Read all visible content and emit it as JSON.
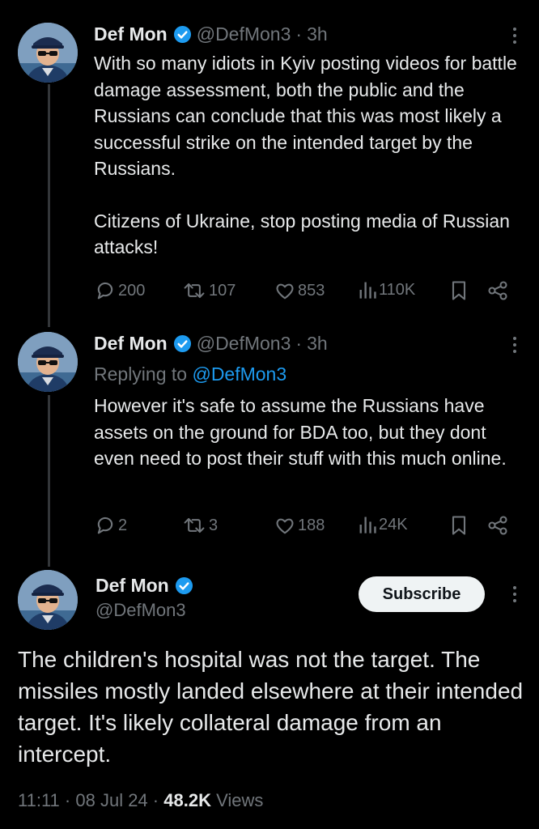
{
  "tweet1": {
    "name": "Def Mon",
    "handle": "@DefMon3",
    "separator": "·",
    "time": "3h",
    "paragraph1": "With so many idiots in Kyiv posting videos for battle damage assessment, both the public and the Russians can conclude that this was most likely a successful strike on the intended target by the Russians.",
    "paragraph2": "Citizens of Ukraine, stop posting media of Russian attacks!",
    "replies": "200",
    "reposts": "107",
    "likes": "853",
    "views": "110K"
  },
  "tweet2": {
    "name": "Def Mon",
    "handle": "@DefMon3",
    "separator": "·",
    "time": "3h",
    "replying_label": "Replying to",
    "replying_mention": "@DefMon3",
    "text": "However it's safe to assume the Russians have assets on the ground for BDA too, but they dont even need to post their stuff with this much online.",
    "replies": "2",
    "reposts": "3",
    "likes": "188",
    "views": "24K"
  },
  "main_tweet": {
    "name": "Def Mon",
    "handle": "@DefMon3",
    "subscribe_label": "Subscribe",
    "text": "The children's hospital was not the target. The missiles mostly landed elsewhere at their intended target. It's likely collateral damage from an intercept.",
    "time": "11:11",
    "sep1": "·",
    "date": "08 Jul 24",
    "sep2": "·",
    "views_count": "48.2K",
    "views_label": "Views"
  },
  "colors": {
    "background": "#000000",
    "text": "#e7e9ea",
    "muted": "#71767b",
    "accent": "#1d9bf0"
  },
  "icons": [
    "verified-badge-icon",
    "more-icon",
    "reply-icon",
    "repost-icon",
    "like-icon",
    "views-icon",
    "bookmark-icon",
    "share-icon"
  ]
}
